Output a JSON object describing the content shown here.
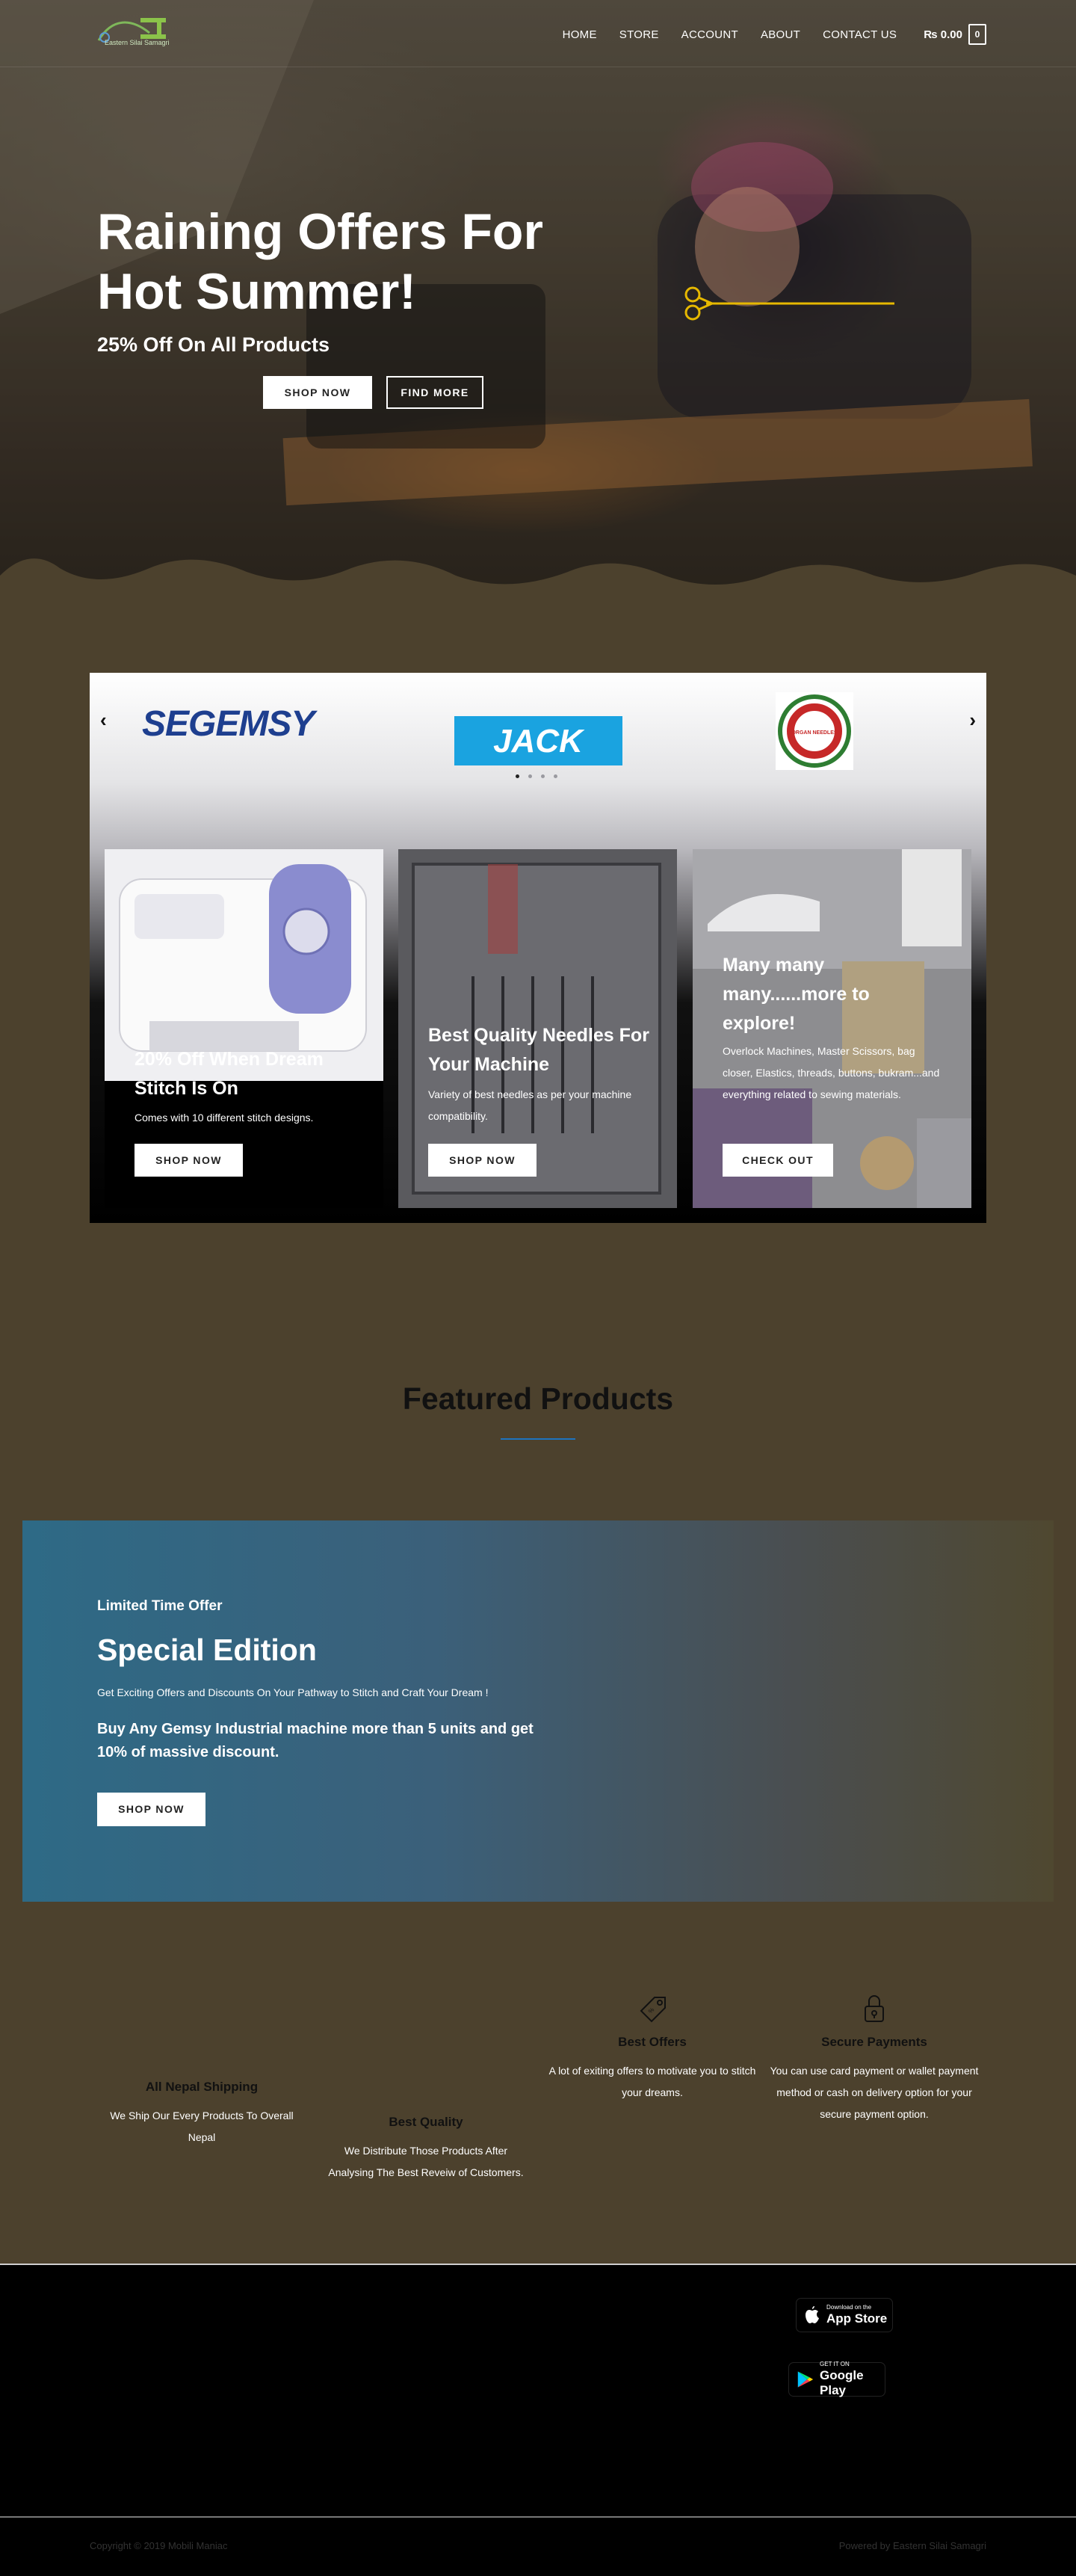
{
  "nav": {
    "logo_text": "Eastern Silai Samagri",
    "items": [
      {
        "label": "HOME"
      },
      {
        "label": "STORE"
      },
      {
        "label": "ACCOUNT"
      },
      {
        "label": "ABOUT"
      },
      {
        "label": "CONTACT US"
      }
    ],
    "cart_amount": "₨ 0.00",
    "cart_count": "0"
  },
  "hero": {
    "title": "Raining Offers For Hot Summer!",
    "subtitle": "25% Off On All Products",
    "primary_button": "SHOP NOW",
    "secondary_button": "FIND MORE"
  },
  "brands": {
    "items": [
      {
        "name": "SEGEMSY"
      },
      {
        "name": "JACK"
      },
      {
        "name": "ORGAN NEEDLES"
      }
    ],
    "prev_arrow": "‹",
    "next_arrow": "›"
  },
  "promos": [
    {
      "title": "20% Off When Dream Stitch Is On",
      "text": "Comes with 10 different stitch designs.",
      "button": "SHOP NOW"
    },
    {
      "title": "Best Quality Needles For Your Machine",
      "text": "Variety of best needles as per your machine compatibility.",
      "button": "SHOP NOW"
    },
    {
      "title": "Many many many......more to explore!",
      "text": "Overlock Machines, Master Scissors, bag closer, Elastics, threads, buttons, bukram...and everything related to sewing materials.",
      "button": "CHECK OUT"
    }
  ],
  "featured": {
    "title": "Featured Products"
  },
  "special": {
    "label": "Limited Time Offer",
    "title": "Special Edition",
    "subtitle": "Get Exciting Offers and Discounts On Your Pathway to Stitch and Craft Your Dream !",
    "description": "Buy Any Gemsy Industrial machine more than 5 units and get 10% of massive discount.",
    "button": "SHOP NOW"
  },
  "features": [
    {
      "icon": "truck-icon",
      "title": "All Nepal Shipping",
      "text": "We Ship Our Every Products To Overall Nepal"
    },
    {
      "icon": "medal-icon",
      "title": "Best Quality",
      "text": "We Distribute Those Products After Analysing The Best Reveiw of Customers."
    },
    {
      "icon": "tag-icon",
      "title": "Best Offers",
      "text": "A lot of exiting offers to motivate you to stitch your dreams."
    },
    {
      "icon": "lock-icon",
      "title": "Secure Payments",
      "text": "You can use card payment or wallet payment method or cash on delivery option for your secure payment option."
    }
  ],
  "footer": {
    "app_store_small": "Download on the",
    "app_store_big": "App Store",
    "google_play_small": "GET IT ON",
    "google_play_big": "Google Play",
    "copyright": "Copyright © 2019 Mobili Maniac",
    "powered": "Powered by Eastern Silai Samagri"
  },
  "colors": {
    "page_background": "#4c412d",
    "accent_line": "#1e73be",
    "jack_blue": "#1aa3e0",
    "special_gradient_start": "#2e6a86"
  }
}
